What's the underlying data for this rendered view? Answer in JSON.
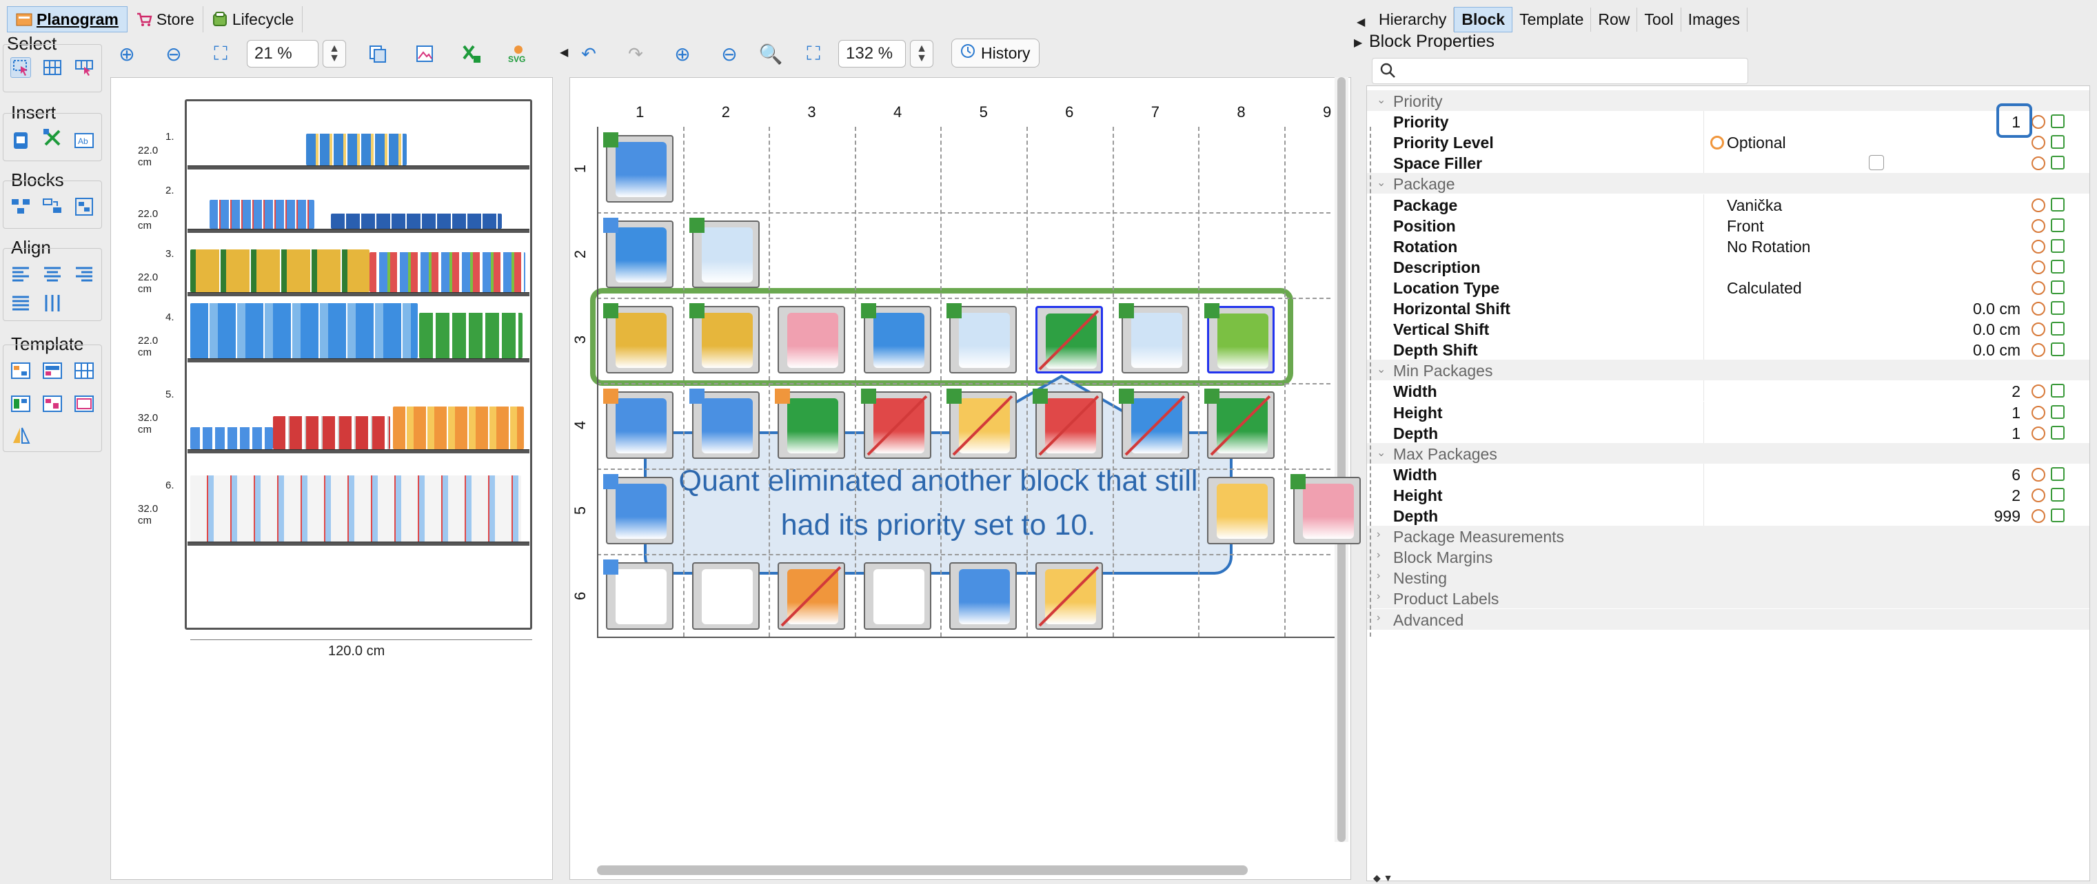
{
  "top_tabs": [
    {
      "label": "Planogram",
      "active": true
    },
    {
      "label": "Store",
      "active": false
    },
    {
      "label": "Lifecycle",
      "active": false
    }
  ],
  "left_panel": {
    "select": {
      "title": "Select"
    },
    "insert": {
      "title": "Insert"
    },
    "blocks": {
      "title": "Blocks"
    },
    "align": {
      "title": "Align"
    },
    "template": {
      "title": "Template"
    }
  },
  "overview_toolbar": {
    "zoom": "21 %"
  },
  "overview": {
    "shelf_dims": [
      "22.0 cm",
      "22.0 cm",
      "22.0 cm",
      "22.0 cm",
      "32.0 cm",
      "32.0 cm"
    ],
    "shelf_nums": [
      "1.",
      "2.",
      "3.",
      "4.",
      "5.",
      "6."
    ],
    "width_label": "120.0 cm"
  },
  "grid_toolbar": {
    "zoom": "132 %",
    "history_label": "History"
  },
  "grid": {
    "columns": [
      "1",
      "2",
      "3",
      "4",
      "5",
      "6",
      "7",
      "8",
      "9"
    ],
    "rows": [
      "1",
      "2",
      "3",
      "4",
      "5",
      "6"
    ]
  },
  "callout": {
    "text": "Quant eliminated another block that still had its priority set to 10."
  },
  "right_tabs": [
    {
      "label": "Hierarchy",
      "active": false
    },
    {
      "label": "Block",
      "active": true
    },
    {
      "label": "Template",
      "active": false
    },
    {
      "label": "Row",
      "active": false
    },
    {
      "label": "Tool",
      "active": false
    },
    {
      "label": "Images",
      "active": false
    }
  ],
  "properties": {
    "title": "Block Properties",
    "search_placeholder": "",
    "rows": [
      {
        "kind": "section",
        "name": "Priority",
        "open": true
      },
      {
        "kind": "prop",
        "name": "Priority",
        "num": "1"
      },
      {
        "kind": "prop",
        "name": "Priority Level",
        "val": "Optional"
      },
      {
        "kind": "prop",
        "name": "Space Filler",
        "check": false
      },
      {
        "kind": "section",
        "name": "Package",
        "open": true
      },
      {
        "kind": "prop",
        "name": "Package",
        "val": "Vanička"
      },
      {
        "kind": "prop",
        "name": "Position",
        "val": "Front"
      },
      {
        "kind": "prop",
        "name": "Rotation",
        "val": "No Rotation"
      },
      {
        "kind": "prop",
        "name": "Description",
        "val": ""
      },
      {
        "kind": "prop",
        "name": "Location Type",
        "val": "Calculated"
      },
      {
        "kind": "prop",
        "name": "Horizontal Shift",
        "num": "0.0 cm"
      },
      {
        "kind": "prop",
        "name": "Vertical Shift",
        "num": "0.0 cm"
      },
      {
        "kind": "prop",
        "name": "Depth Shift",
        "num": "0.0 cm"
      },
      {
        "kind": "section",
        "name": "Min Packages",
        "open": true
      },
      {
        "kind": "prop",
        "name": "Width",
        "num": "2"
      },
      {
        "kind": "prop",
        "name": "Height",
        "num": "1"
      },
      {
        "kind": "prop",
        "name": "Depth",
        "num": "1"
      },
      {
        "kind": "section",
        "name": "Max Packages",
        "open": true
      },
      {
        "kind": "prop",
        "name": "Width",
        "num": "6"
      },
      {
        "kind": "prop",
        "name": "Height",
        "num": "2"
      },
      {
        "kind": "prop",
        "name": "Depth",
        "num": "999"
      },
      {
        "kind": "section",
        "name": "Package Measurements",
        "open": false
      },
      {
        "kind": "section",
        "name": "Block Margins",
        "open": false
      },
      {
        "kind": "section",
        "name": "Nesting",
        "open": false
      },
      {
        "kind": "section",
        "name": "Product Labels",
        "open": false
      },
      {
        "kind": "section",
        "name": "Advanced",
        "open": false
      }
    ]
  },
  "colors": {
    "accent": "#2f73c0",
    "selection_green": "#6aa84f",
    "marker_green": "#3c9a3c",
    "marker_blue": "#4a90e2",
    "marker_orange": "#f0963c",
    "cross_red": "#d23a3a"
  }
}
